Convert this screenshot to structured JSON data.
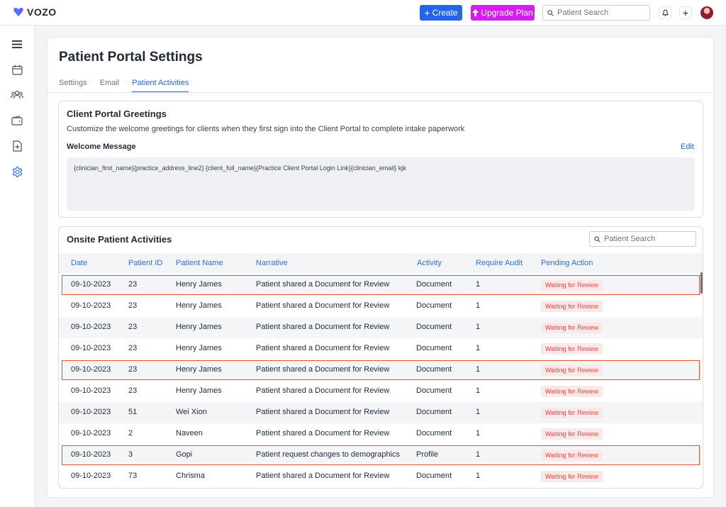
{
  "app": {
    "logo_text": "VOZO"
  },
  "topbar": {
    "create_label": "Create",
    "upgrade_label": "Upgrade Plan",
    "search_placeholder": "Patient Search"
  },
  "sidebar": {
    "items": [
      {
        "icon": "menu-icon"
      },
      {
        "icon": "calendar-icon"
      },
      {
        "icon": "users-icon"
      },
      {
        "icon": "wallet-icon"
      },
      {
        "icon": "document-add-icon"
      },
      {
        "icon": "gear-icon",
        "active": true
      }
    ]
  },
  "page": {
    "title": "Patient Portal Settings",
    "tabs": [
      {
        "label": "Settings",
        "active": false
      },
      {
        "label": "Email",
        "active": false
      },
      {
        "label": "Patient Activities",
        "active": true
      }
    ]
  },
  "greetings": {
    "title": "Client Portal Greetings",
    "description": "Customize the welcome greetings for clients when they first sign into the Client Portal to complete intake paperwork",
    "welcome_label": "Welcome Message",
    "edit_label": "Edit",
    "message": "{clinician_first_name}{practice_address_line2} {client_full_name}{Practice Client Portal Login Link}{clinician_email} kjk"
  },
  "activities": {
    "title": "Onsite Patient Activities",
    "search_placeholder": "Patient Search",
    "columns": [
      "Date",
      "Patient ID",
      "Patient Name",
      "Narrative",
      "Activity",
      "Require Audit",
      "Pending Action"
    ],
    "rows": [
      {
        "date": "09-10-2023",
        "id": "23",
        "name": "Henry James",
        "narrative": "Patient shared a Document for Review",
        "activity": "Document",
        "audit": "1",
        "pending": "Waiting for Review",
        "highlight": true
      },
      {
        "date": "09-10-2023",
        "id": "23",
        "name": "Henry James",
        "narrative": "Patient shared a Document for Review",
        "activity": "Document",
        "audit": "1",
        "pending": "Waiting for Review",
        "highlight": false
      },
      {
        "date": "09-10-2023",
        "id": "23",
        "name": "Henry James",
        "narrative": "Patient shared a Document for Review",
        "activity": "Document",
        "audit": "1",
        "pending": "Waiting for Review",
        "highlight": false
      },
      {
        "date": "09-10-2023",
        "id": "23",
        "name": "Henry James",
        "narrative": "Patient shared a Document for Review",
        "activity": "Document",
        "audit": "1",
        "pending": "Waiting for Review",
        "highlight": false
      },
      {
        "date": "09-10-2023",
        "id": "23",
        "name": "Henry James",
        "narrative": "Patient shared a Document for Review",
        "activity": "Document",
        "audit": "1",
        "pending": "Waiting for Review",
        "highlight": true
      },
      {
        "date": "09-10-2023",
        "id": "23",
        "name": "Henry James",
        "narrative": "Patient shared a Document for Review",
        "activity": "Document",
        "audit": "1",
        "pending": "Waiting for Review",
        "highlight": false
      },
      {
        "date": "09-10-2023",
        "id": "51",
        "name": "Wei Xion",
        "narrative": "Patient shared a Document for Review",
        "activity": "Document",
        "audit": "1",
        "pending": "Waiting for Review",
        "highlight": false
      },
      {
        "date": "09-10-2023",
        "id": "2",
        "name": "Naveen",
        "narrative": "Patient shared a Document for Review",
        "activity": "Document",
        "audit": "1",
        "pending": "Waiting for Review",
        "highlight": false
      },
      {
        "date": "09-10-2023",
        "id": "3",
        "name": "Gopi",
        "narrative": "Patient request changes to demographics",
        "activity": "Profile",
        "audit": "1",
        "pending": "Waiting for Review",
        "highlight": true
      },
      {
        "date": "09-10-2023",
        "id": "73",
        "name": "Chrisma",
        "narrative": "Patient shared a Document for Review",
        "activity": "Document",
        "audit": "1",
        "pending": "Waiting for Review",
        "highlight": false
      }
    ]
  },
  "colors": {
    "primary": "#2563eb",
    "upgrade": "#d21ff0",
    "highlight_border": "#e4572e",
    "badge_text": "#ef4444",
    "badge_bg": "#fde8e8"
  }
}
